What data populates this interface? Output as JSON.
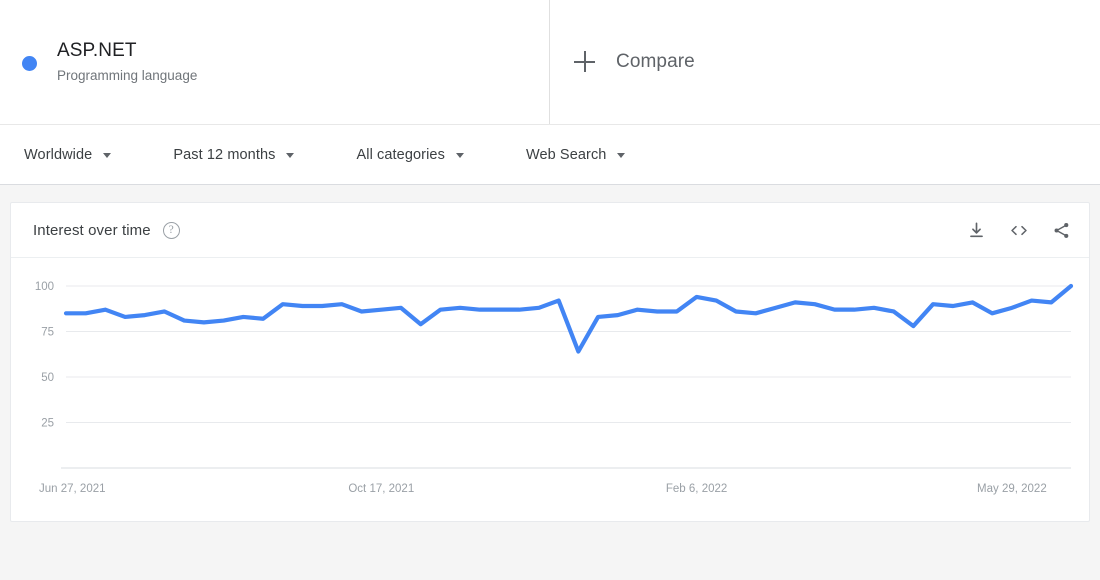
{
  "term": {
    "name": "ASP.NET",
    "subtitle": "Programming language",
    "dot_color": "#4285f4"
  },
  "compare": {
    "label": "Compare",
    "icon": "plus-icon"
  },
  "filters": [
    {
      "label": "Worldwide"
    },
    {
      "label": "Past 12 months"
    },
    {
      "label": "All categories"
    },
    {
      "label": "Web Search"
    }
  ],
  "panel": {
    "title": "Interest over time",
    "help_icon": "?",
    "actions": [
      {
        "name": "download-icon"
      },
      {
        "name": "embed-icon"
      },
      {
        "name": "share-icon"
      }
    ]
  },
  "chart_data": {
    "type": "line",
    "title": "Interest over time",
    "xlabel": "",
    "ylabel": "",
    "ylim": [
      0,
      100
    ],
    "yticks": [
      25,
      50,
      75,
      100
    ],
    "grid": true,
    "legend": false,
    "line_color": "#4285f4",
    "xtick_labels": [
      "Jun 27, 2021",
      "Oct 17, 2021",
      "Feb 6, 2022",
      "May 29, 2022"
    ],
    "xtick_positions": [
      0,
      16,
      32,
      48
    ],
    "series": [
      {
        "name": "ASP.NET",
        "values": [
          85,
          85,
          87,
          83,
          84,
          86,
          81,
          80,
          81,
          83,
          82,
          90,
          89,
          89,
          90,
          86,
          87,
          88,
          79,
          87,
          88,
          87,
          87,
          87,
          88,
          92,
          64,
          83,
          84,
          87,
          86,
          86,
          94,
          92,
          86,
          85,
          88,
          91,
          90,
          87,
          87,
          88,
          86,
          78,
          90,
          89,
          91,
          85,
          88,
          92,
          91,
          100
        ]
      }
    ]
  }
}
